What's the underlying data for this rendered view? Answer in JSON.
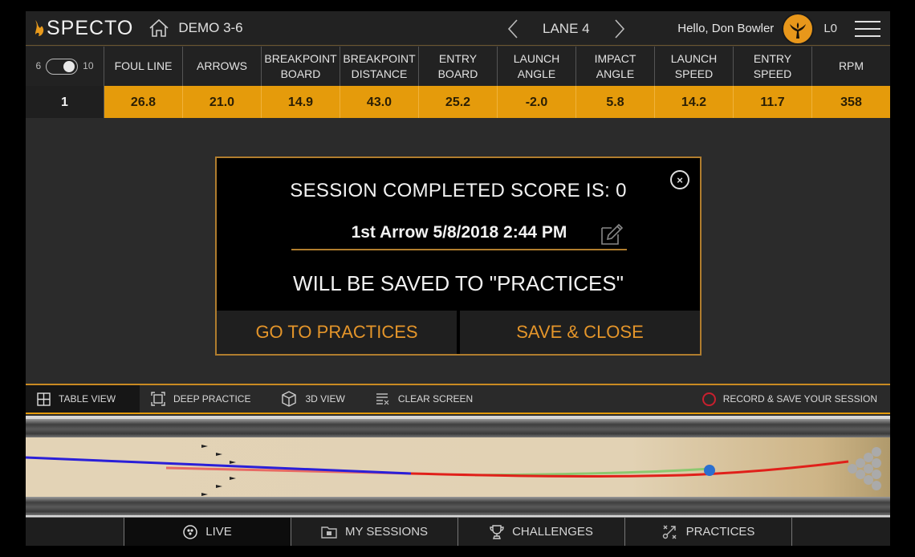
{
  "header": {
    "brand": "SPECTO",
    "session_name": "DEMO 3-6",
    "lane_label": "LANE 4",
    "greeting": "Hello, Don Bowler",
    "level": "L0"
  },
  "stats_table": {
    "toggle": {
      "left_label": "6",
      "right_label": "10",
      "state": "on"
    },
    "columns": [
      "FOUL LINE",
      "ARROWS",
      "BREAKPOINT BOARD",
      "BREAKPOINT DISTANCE",
      "ENTRY BOARD",
      "LAUNCH ANGLE",
      "IMPACT ANGLE",
      "LAUNCH SPEED",
      "ENTRY SPEED",
      "RPM"
    ],
    "rows": [
      {
        "shot": "1",
        "values": [
          "26.8",
          "21.0",
          "14.9",
          "43.0",
          "25.2",
          "-2.0",
          "5.8",
          "14.2",
          "11.7",
          "358"
        ]
      }
    ]
  },
  "modal": {
    "title": "SESSION COMPLETED SCORE IS: 0",
    "session_name_value": "1st Arrow 5/8/2018 2:44 PM",
    "message": "WILL BE SAVED TO \"PRACTICES\"",
    "go_button": "GO TO PRACTICES",
    "save_button": "SAVE & CLOSE"
  },
  "view_bar": {
    "items": [
      {
        "label": "TABLE VIEW",
        "icon": "grid-icon",
        "active": true
      },
      {
        "label": "DEEP PRACTICE",
        "icon": "frame-icon",
        "active": false
      },
      {
        "label": "3D VIEW",
        "icon": "cube-icon",
        "active": false
      },
      {
        "label": "CLEAR SCREEN",
        "icon": "clear-list-icon",
        "active": false
      }
    ],
    "record_label": "RECORD & SAVE YOUR SESSION"
  },
  "bottom_nav": {
    "items": [
      {
        "label": "LIVE",
        "icon": "bowling-ball-icon",
        "active": true
      },
      {
        "label": "MY SESSIONS",
        "icon": "folder-icon",
        "active": false
      },
      {
        "label": "CHALLENGES",
        "icon": "trophy-icon",
        "active": false
      },
      {
        "label": "PRACTICES",
        "icon": "strategy-icon",
        "active": false
      }
    ]
  },
  "colors": {
    "accent": "#e59b0b",
    "modal_border": "#b07d2e",
    "button_text": "#e4952a",
    "record": "#c8202e",
    "path_blue": "#2a1fd8",
    "path_red": "#e0201a",
    "path_green": "#8cc870",
    "ball": "#2a6fd0"
  }
}
